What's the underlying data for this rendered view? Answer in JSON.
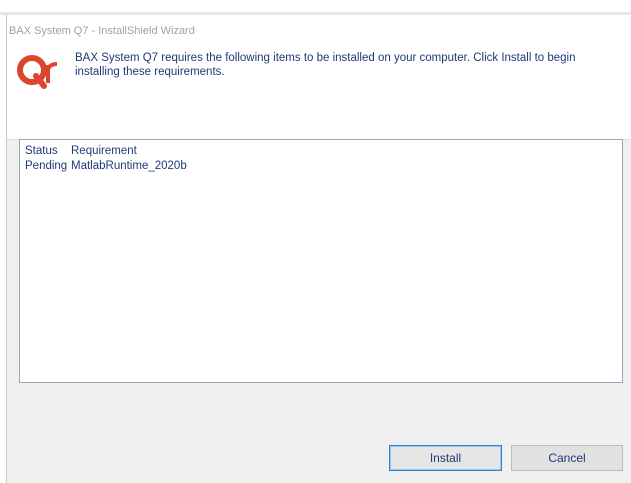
{
  "window": {
    "title": "BAX System Q7 - InstallShield Wizard"
  },
  "header": {
    "message": "BAX System Q7 requires the following items to be installed on your computer. Click Install to begin installing these requirements."
  },
  "requirements": {
    "columns": [
      "Status",
      "Requirement"
    ],
    "rows": [
      {
        "status": "Pending",
        "requirement": "MatlabRuntime_2020b"
      }
    ]
  },
  "buttons": {
    "install_label": "Install",
    "cancel_label": "Cancel"
  },
  "colors": {
    "accent": "#2f7fd2",
    "logo": "#d9462b",
    "text": "#1d3a78"
  },
  "icons": {
    "logo": "qt-logo-icon"
  }
}
